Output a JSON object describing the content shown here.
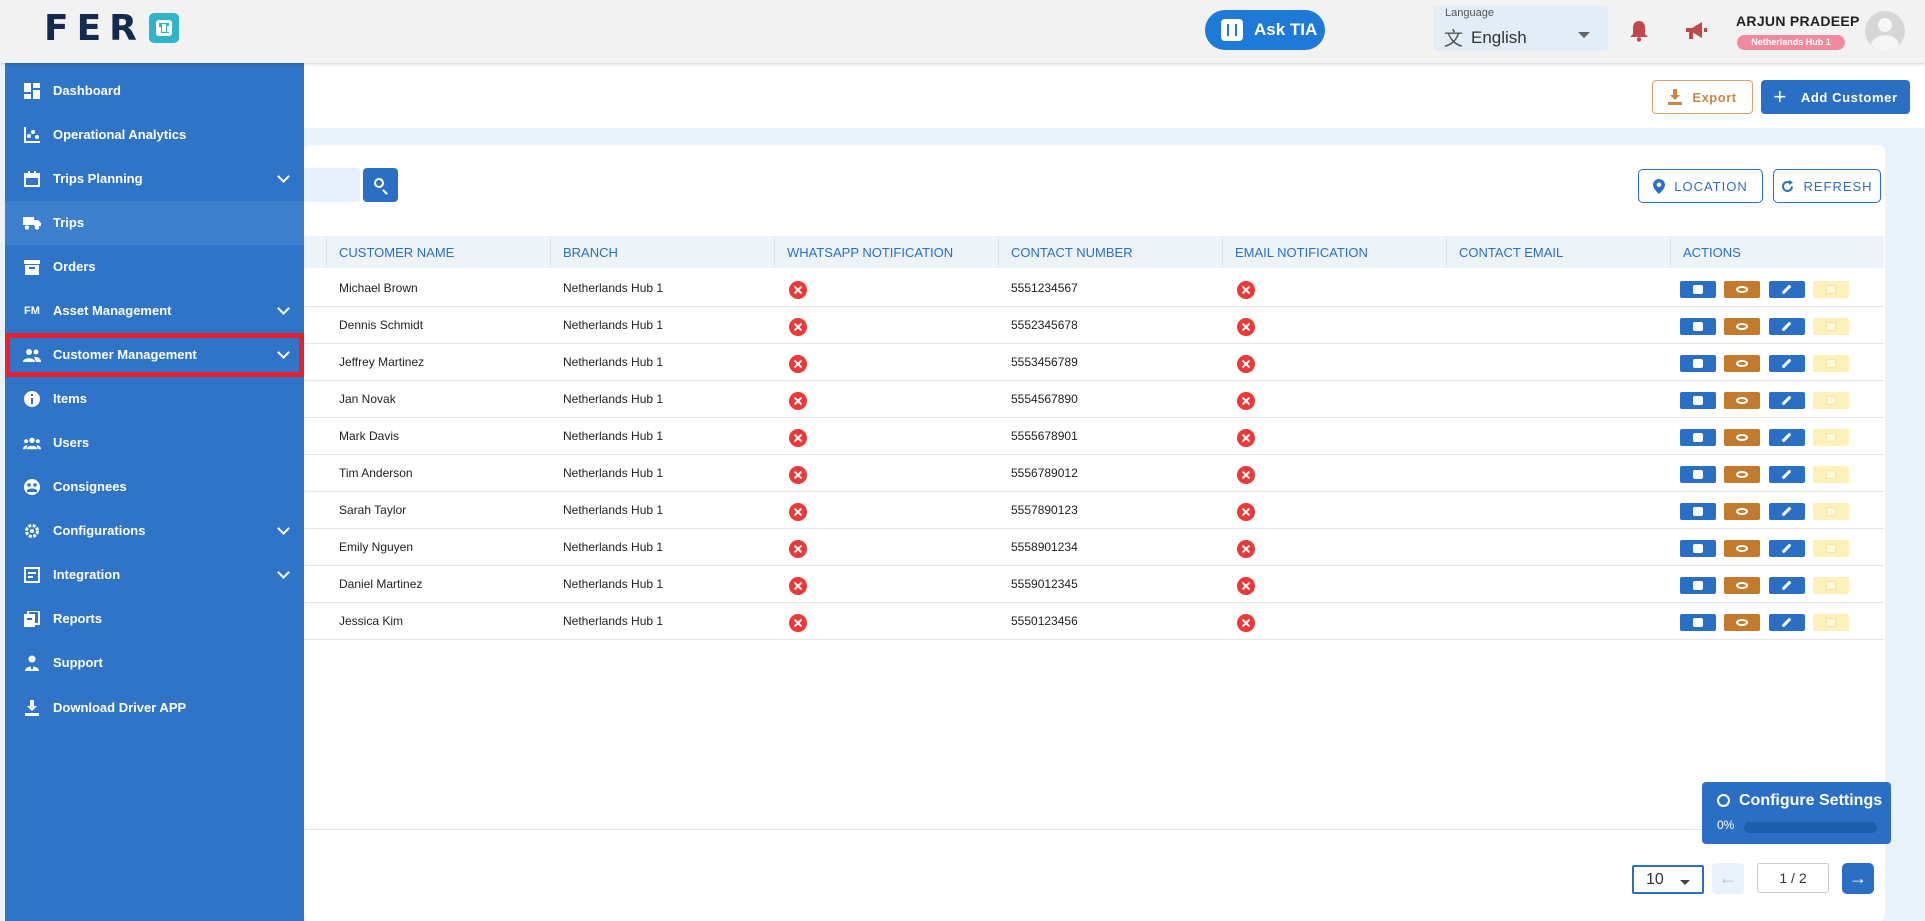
{
  "header": {
    "logo_text": "FER",
    "ask_tia_label": "Ask TIA",
    "language_label": "Language",
    "language_value": "English",
    "user_name": "ARJUN PRADEEP",
    "user_hub": "Netherlands Hub 1"
  },
  "sidebar": {
    "items": [
      {
        "label": "Dashboard",
        "icon": "dashboard-icon"
      },
      {
        "label": "Operational Analytics",
        "icon": "analytics-icon"
      },
      {
        "label": "Trips Planning",
        "icon": "calendar-icon"
      },
      {
        "label": "Trips",
        "icon": "truck-icon"
      },
      {
        "label": "Orders",
        "icon": "box-icon"
      },
      {
        "label": "Asset Management",
        "icon": "fm-icon"
      },
      {
        "label": "Customer Management",
        "icon": "people-icon"
      },
      {
        "label": "Items",
        "icon": "info-icon"
      },
      {
        "label": "Users",
        "icon": "users-icon"
      },
      {
        "label": "Consignees",
        "icon": "consignee-icon"
      },
      {
        "label": "Configurations",
        "icon": "gear-icon"
      },
      {
        "label": "Integration",
        "icon": "integration-icon"
      },
      {
        "label": "Reports",
        "icon": "reports-icon"
      },
      {
        "label": "Support",
        "icon": "support-icon"
      },
      {
        "label": "Download Driver APP",
        "icon": "download-icon"
      }
    ]
  },
  "toolbar": {
    "export_label": "Export",
    "add_customer_label": "Add Customer",
    "location_label": "LOCATION",
    "refresh_label": "REFRESH"
  },
  "table": {
    "columns": [
      "CUSTOMER NAME",
      "BRANCH",
      "WHATSAPP NOTIFICATION",
      "CONTACT NUMBER",
      "EMAIL NOTIFICATION",
      "CONTACT EMAIL",
      "ACTIONS"
    ],
    "rows": [
      {
        "name": "Michael Brown",
        "branch": "Netherlands Hub 1",
        "contact": "5551234567",
        "email": ""
      },
      {
        "name": "Dennis Schmidt",
        "branch": "Netherlands Hub 1",
        "contact": "5552345678",
        "email": ""
      },
      {
        "name": "Jeffrey Martinez",
        "branch": "Netherlands Hub 1",
        "contact": "5553456789",
        "email": ""
      },
      {
        "name": "Jan Novak",
        "branch": "Netherlands Hub 1",
        "contact": "5554567890",
        "email": ""
      },
      {
        "name": "Mark Davis",
        "branch": "Netherlands Hub 1",
        "contact": "5555678901",
        "email": ""
      },
      {
        "name": "Tim Anderson",
        "branch": "Netherlands Hub 1",
        "contact": "5556789012",
        "email": ""
      },
      {
        "name": "Sarah Taylor",
        "branch": "Netherlands Hub 1",
        "contact": "5557890123",
        "email": ""
      },
      {
        "name": "Emily Nguyen",
        "branch": "Netherlands Hub 1",
        "contact": "5558901234",
        "email": ""
      },
      {
        "name": "Daniel Martinez",
        "branch": "Netherlands Hub 1",
        "contact": "5559012345",
        "email": ""
      },
      {
        "name": "Jessica Kim",
        "branch": "Netherlands Hub 1",
        "contact": "5550123456",
        "email": ""
      }
    ]
  },
  "config_widget": {
    "title": "Configure Settings",
    "progress_text": "0%",
    "progress": 0
  },
  "pagination": {
    "page_size": "10",
    "page_indicator": "1 / 2"
  },
  "colors": {
    "primary": "#2a6fc4",
    "sidebar": "#2f74c6",
    "error": "#e93a3a",
    "highlight": "#e52030"
  }
}
